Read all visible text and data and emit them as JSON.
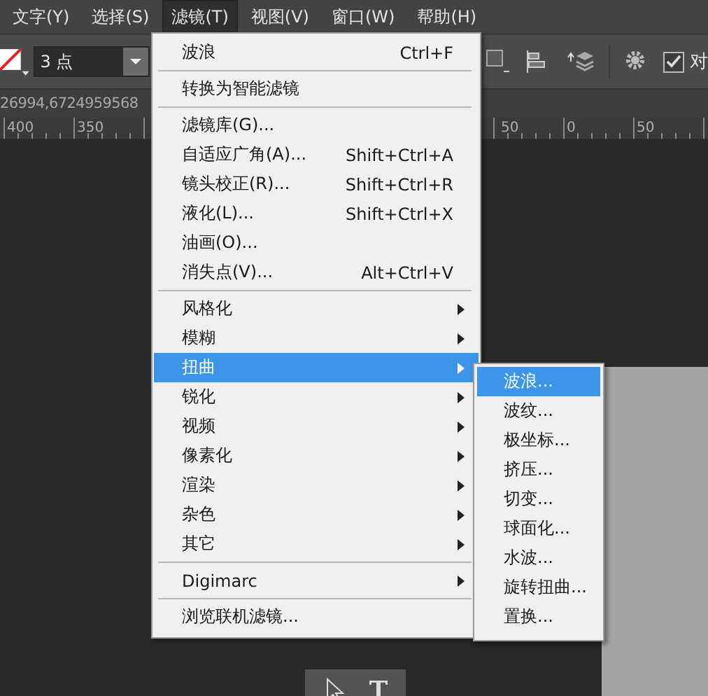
{
  "menubar": [
    {
      "label": "文字(Y)",
      "selected": false
    },
    {
      "label": "选择(S)",
      "selected": false
    },
    {
      "label": "滤镜(T)",
      "selected": true
    },
    {
      "label": "视图(V)",
      "selected": false
    },
    {
      "label": "窗口(W)",
      "selected": false
    },
    {
      "label": "帮助(H)",
      "selected": false
    }
  ],
  "toolbar": {
    "size_field": {
      "value": "3 点"
    },
    "checkbox": {
      "checked": true,
      "label": "对"
    }
  },
  "document_info": "26994,6724959568",
  "ruler": [
    "400",
    "350",
    "50",
    "0",
    "50"
  ],
  "filter_menu": [
    {
      "kind": "item",
      "label": "波浪",
      "shortcut": "Ctrl+F",
      "selected": false
    },
    {
      "kind": "separator"
    },
    {
      "kind": "item",
      "label": "转换为智能滤镜",
      "selected": false
    },
    {
      "kind": "separator"
    },
    {
      "kind": "item",
      "label": "滤镜库(G)...",
      "selected": false
    },
    {
      "kind": "item",
      "label": "自适应广角(A)...",
      "shortcut": "Shift+Ctrl+A",
      "selected": false
    },
    {
      "kind": "item",
      "label": "镜头校正(R)...",
      "shortcut": "Shift+Ctrl+R",
      "selected": false
    },
    {
      "kind": "item",
      "label": "液化(L)...",
      "shortcut": "Shift+Ctrl+X",
      "selected": false
    },
    {
      "kind": "item",
      "label": "油画(O)...",
      "selected": false
    },
    {
      "kind": "item",
      "label": "消失点(V)...",
      "shortcut": "Alt+Ctrl+V",
      "selected": false
    },
    {
      "kind": "separator"
    },
    {
      "kind": "submenu",
      "label": "风格化",
      "selected": false
    },
    {
      "kind": "submenu",
      "label": "模糊",
      "selected": false
    },
    {
      "kind": "submenu",
      "label": "扭曲",
      "selected": true
    },
    {
      "kind": "submenu",
      "label": "锐化",
      "selected": false
    },
    {
      "kind": "submenu",
      "label": "视频",
      "selected": false
    },
    {
      "kind": "submenu",
      "label": "像素化",
      "selected": false
    },
    {
      "kind": "submenu",
      "label": "渲染",
      "selected": false
    },
    {
      "kind": "submenu",
      "label": "杂色",
      "selected": false
    },
    {
      "kind": "submenu",
      "label": "其它",
      "selected": false
    },
    {
      "kind": "separator"
    },
    {
      "kind": "submenu",
      "label": "Digimarc",
      "selected": false
    },
    {
      "kind": "separator"
    },
    {
      "kind": "item",
      "label": "浏览联机滤镜...",
      "selected": false
    }
  ],
  "distort_submenu": [
    {
      "label": "波浪...",
      "selected": true
    },
    {
      "label": "波纹...",
      "selected": false
    },
    {
      "label": "极坐标...",
      "selected": false
    },
    {
      "label": "挤压...",
      "selected": false
    },
    {
      "label": "切变...",
      "selected": false
    },
    {
      "label": "球面化...",
      "selected": false
    },
    {
      "label": "水波...",
      "selected": false
    },
    {
      "label": "旋转扭曲...",
      "selected": false
    },
    {
      "label": "置换...",
      "selected": false
    }
  ]
}
